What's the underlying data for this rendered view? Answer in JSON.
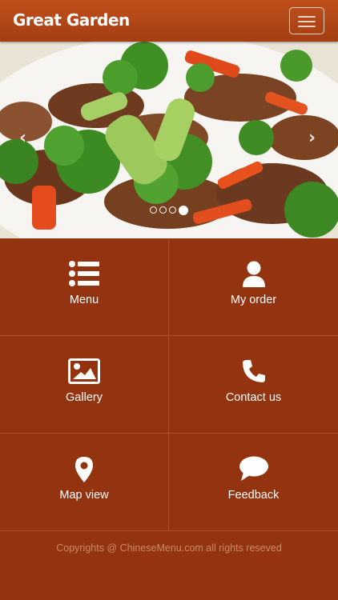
{
  "header": {
    "brand": "Great Garden"
  },
  "carousel": {
    "slides": 4,
    "active_index": 3
  },
  "tiles": [
    {
      "label": "Menu",
      "icon": "list-icon"
    },
    {
      "label": "My order",
      "icon": "user-icon"
    },
    {
      "label": "Gallery",
      "icon": "image-icon"
    },
    {
      "label": "Contact us",
      "icon": "phone-icon"
    },
    {
      "label": "Map view",
      "icon": "map-marker-icon"
    },
    {
      "label": "Feedback",
      "icon": "speech-bubble-icon"
    }
  ],
  "footer": {
    "text": "Copyrights @ ChineseMenu.com all rights reseved"
  },
  "colors": {
    "header": "#b5471a",
    "background": "#93330f",
    "accent_text": "#ffffff"
  }
}
